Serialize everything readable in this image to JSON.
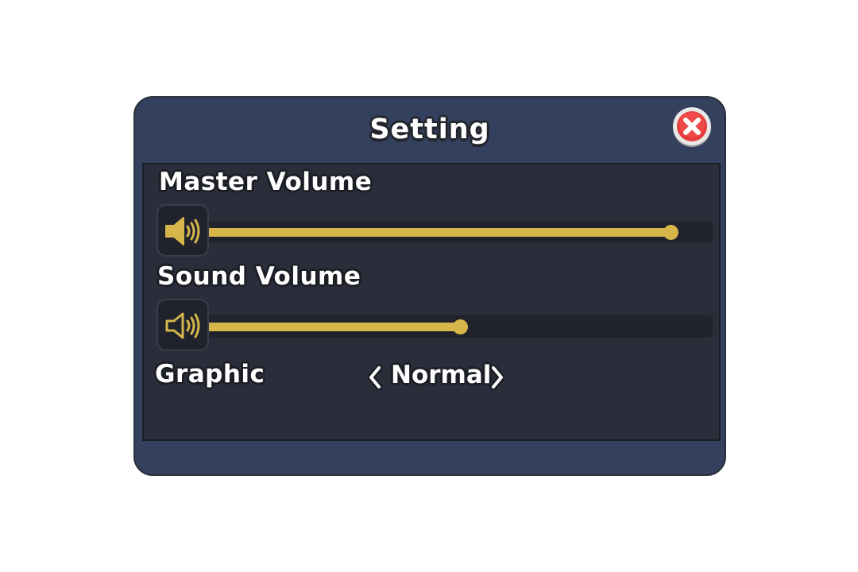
{
  "dialog": {
    "title": "Setting"
  },
  "master_volume": {
    "label": "Master Volume",
    "icon": "speaker-filled-icon",
    "level": 1.0
  },
  "sound_volume": {
    "label": "Sound Volume",
    "icon": "speaker-outline-icon",
    "level": 0.55
  },
  "graphic": {
    "label": "Graphic",
    "value": "Normal"
  },
  "colors": {
    "panel": "#33415e",
    "content": "#2b2d3a",
    "accent": "#d6b54a",
    "close": "#e53b3b"
  }
}
